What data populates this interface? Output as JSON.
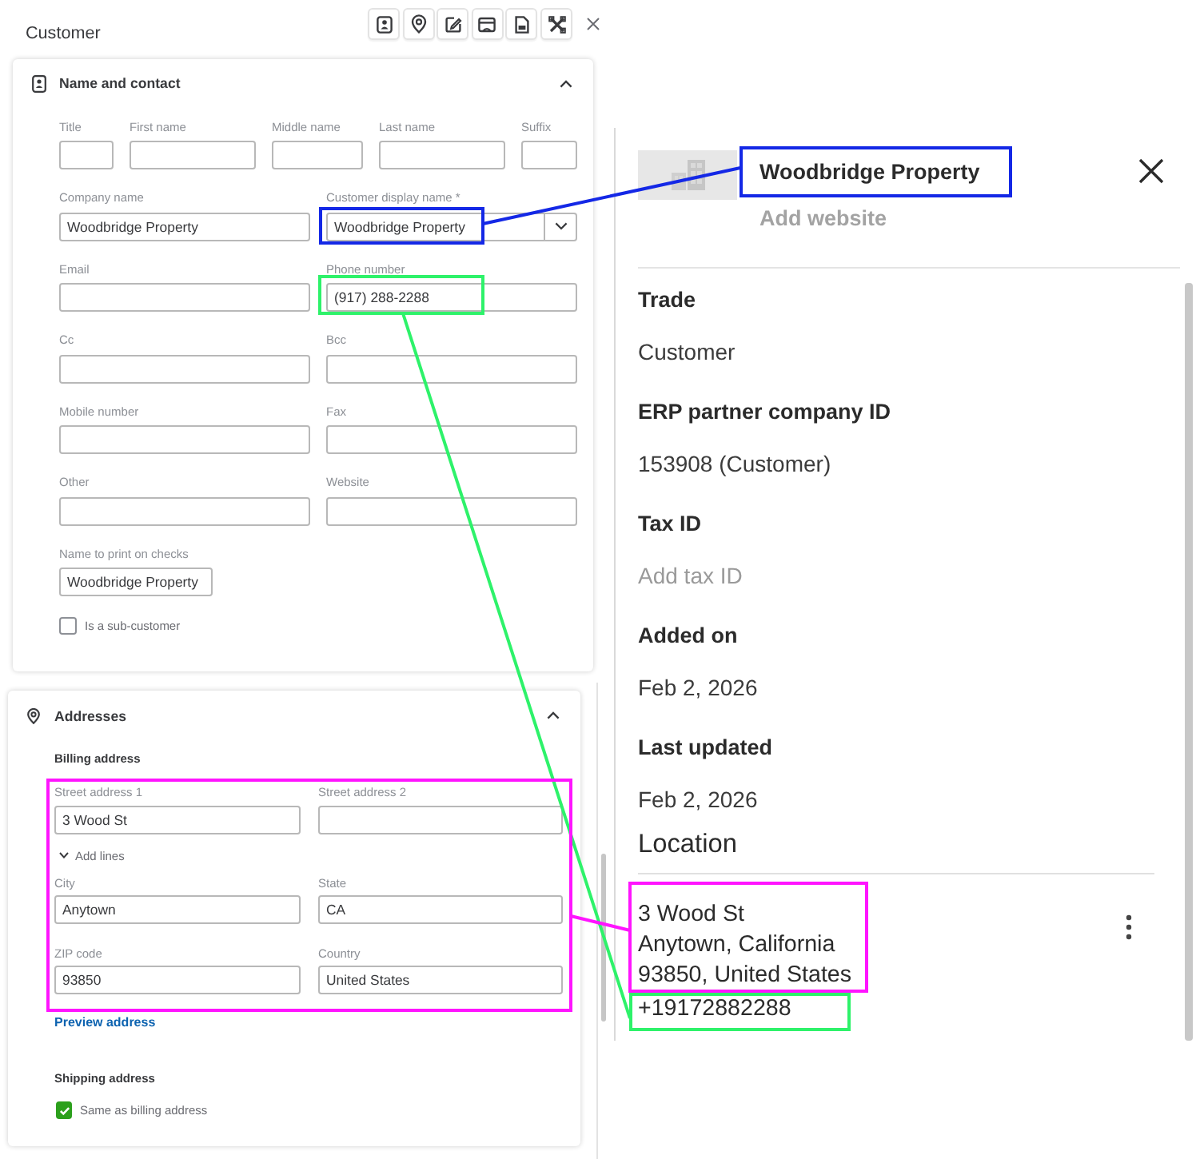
{
  "header": {
    "title": "Customer"
  },
  "name_contact": {
    "title": "Name and contact",
    "expanded": true,
    "rows": [
      [
        {
          "label": "Title",
          "kind": "text"
        },
        {
          "label": "First name",
          "kind": "text"
        },
        {
          "label": "Middle name",
          "kind": "text"
        },
        {
          "label": "Last name",
          "kind": "text"
        },
        {
          "label": "Suffix",
          "kind": "text"
        }
      ],
      [
        {
          "label": "Company name",
          "kind": "text",
          "value": "Woodbridge Property"
        },
        {
          "label": "Customer display name *",
          "kind": "select",
          "value": "Woodbridge Property"
        }
      ],
      [
        {
          "label": "Email",
          "kind": "text"
        },
        {
          "label": "Phone number",
          "kind": "text",
          "value": "(917) 288-2288"
        }
      ],
      [
        {
          "label": "Cc",
          "kind": "text"
        },
        {
          "label": "Bcc",
          "kind": "text"
        }
      ],
      [
        {
          "label": "Mobile number",
          "kind": "text"
        },
        {
          "label": "Fax",
          "kind": "text"
        }
      ],
      [
        {
          "label": "Other",
          "kind": "text"
        },
        {
          "label": "Website",
          "kind": "text"
        }
      ],
      [
        {
          "label": "Name to print on checks",
          "kind": "text",
          "value": "Woodbridge Property"
        }
      ]
    ],
    "sub_customer": {
      "label": "Is a sub-customer",
      "checked": false
    }
  },
  "addresses": {
    "title": "Addresses",
    "expanded": true,
    "billing": {
      "heading": "Billing address",
      "street_row": [
        {
          "label": "Street address 1",
          "value": "3 Wood St"
        },
        {
          "label": "Street address 2"
        }
      ],
      "add_lines": "Add lines",
      "rows": [
        [
          {
            "label": "City",
            "value": "Anytown"
          },
          {
            "label": "State",
            "value": "CA"
          }
        ],
        [
          {
            "label": "ZIP code",
            "value": "93850"
          },
          {
            "label": "Country",
            "value": "United States"
          }
        ]
      ],
      "preview_link": "Preview address"
    },
    "shipping": {
      "heading": "Shipping address",
      "same_as_billing": {
        "label": "Same as billing address",
        "checked": true
      }
    }
  },
  "profile": {
    "name": "Woodbridge Property",
    "website_link": "Add website"
  },
  "details": [
    {
      "label": "Trade",
      "value": "Customer"
    },
    {
      "label": "ERP partner company ID",
      "value": "153908 (Customer)"
    },
    {
      "label": "Tax ID",
      "prompt": "Add tax ID"
    },
    {
      "label": "Added on",
      "value": "Feb 2, 2026"
    },
    {
      "label": "Last updated",
      "value": "Feb 2, 2026"
    }
  ],
  "location": {
    "heading": "Location",
    "address_lines": [
      "3 Wood St",
      "Anytown, California",
      "93850, United States"
    ],
    "phone": "+19172882288"
  },
  "annotations": [
    {
      "color": "#1428e6"
    },
    {
      "color": "#2ef26a"
    },
    {
      "color": "#ff14ff"
    }
  ]
}
